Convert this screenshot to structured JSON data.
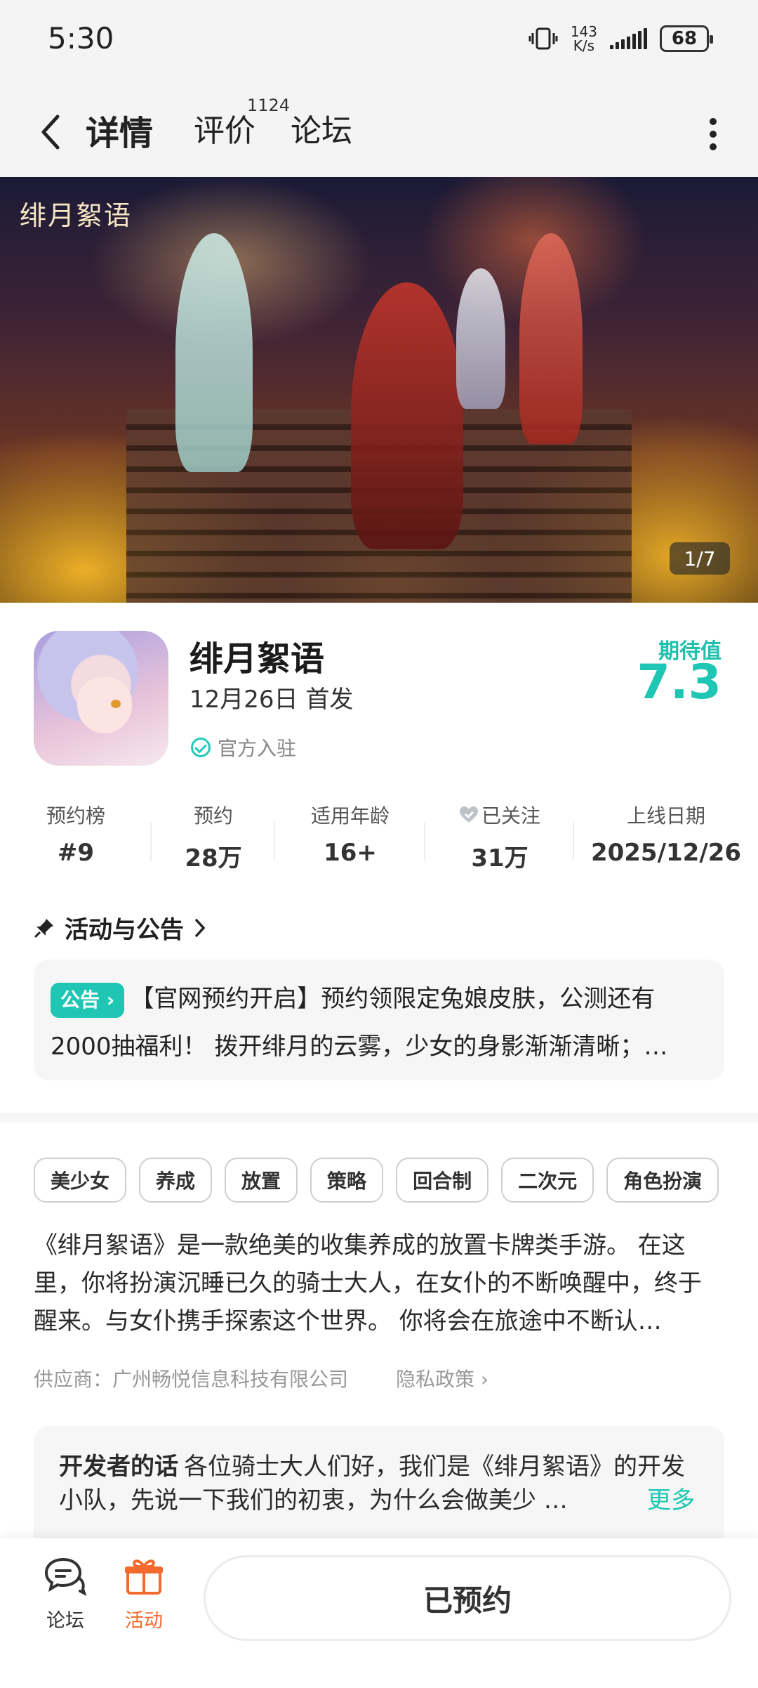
{
  "status": {
    "time": "5:30",
    "net_speed": "143",
    "net_unit": "K/s",
    "battery": "68"
  },
  "nav": {
    "tab_detail": "详情",
    "tab_reviews": "评价",
    "reviews_count": "1124",
    "tab_forum": "论坛"
  },
  "banner": {
    "logo": "绯月絮语",
    "counter": "1/7"
  },
  "app": {
    "name": "绯月絮语",
    "release": "12月26日 首发",
    "official": "官方入驻",
    "score_label": "期待值",
    "score": "7.3"
  },
  "stats": [
    {
      "label": "预约榜",
      "value": "#9"
    },
    {
      "label": "预约",
      "value": "28万"
    },
    {
      "label": "适用年龄",
      "value": "16+"
    },
    {
      "label": "已关注",
      "value": "31万"
    },
    {
      "label": "上线日期",
      "value": "2025/12/26"
    }
  ],
  "announcements": {
    "title": "活动与公告",
    "badge": "公告",
    "text": "【官网预约开启】预约领限定兔娘皮肤，公测还有2000抽福利！ 拨开绯月的云雾，少女的身影渐渐清晰；…"
  },
  "tags": [
    "美少女",
    "养成",
    "放置",
    "策略",
    "回合制",
    "二次元",
    "角色扮演"
  ],
  "description": "《绯月絮语》是一款绝美的收集养成的放置卡牌类手游。 在这里，你将扮演沉睡已久的骑士大人，在女仆的不断唤醒中，终于醒来。与女仆携手探索这个世界。 你将会在旅途中不断认…",
  "supplier": "供应商：广州畅悦信息科技有限公司",
  "privacy": "隐私政策",
  "developer": {
    "heading": "开发者的话",
    "text": "各位骑士大人们好，我们是《绯月絮语》的开发小队，先说一下我们的初衷，为什么会做美少 …",
    "more": "更多"
  },
  "bottom": {
    "forum": "论坛",
    "activity": "活动",
    "reserve": "已预约"
  },
  "colors": {
    "accent": "#1ec6b3",
    "activity": "#f36a2e"
  }
}
